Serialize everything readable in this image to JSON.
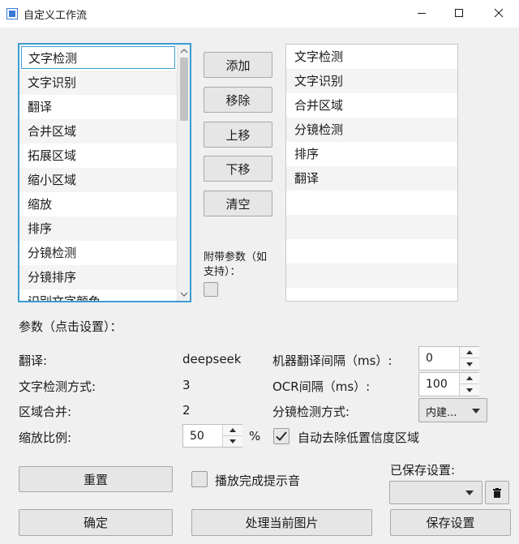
{
  "window": {
    "title": "自定义工作流",
    "minimize_icon": "minimize-icon",
    "maximize_icon": "maximize-icon",
    "close_icon": "close-icon"
  },
  "available_steps": [
    "文字检测",
    "文字识别",
    "翻译",
    "合并区域",
    "拓展区域",
    "缩小区域",
    "缩放",
    "排序",
    "分镜检测",
    "分镜排序",
    "识别文字颜色"
  ],
  "selected_steps": [
    "文字检测",
    "文字识别",
    "合并区域",
    "分镜检测",
    "排序",
    "翻译"
  ],
  "buttons": {
    "add": "添加",
    "remove": "移除",
    "move_up": "上移",
    "move_down": "下移",
    "clear": "清空",
    "reset": "重置",
    "confirm": "确定",
    "process_current": "处理当前图片",
    "save_settings": "保存设置"
  },
  "extra_params": {
    "label": "附带参数（如支持）：",
    "checked": false
  },
  "params": {
    "heading": "参数（点击设置）：",
    "translate_label": "翻译:",
    "translate_value": "deepseek",
    "text_detect_label": "文字检测方式:",
    "text_detect_value": "3",
    "region_merge_label": "区域合并:",
    "region_merge_value": "2",
    "scale_label": "缩放比例:",
    "scale_value": "50",
    "scale_unit": "%",
    "mt_interval_label": "机器翻译间隔（ms）:",
    "mt_interval_value": "0",
    "ocr_interval_label": "OCR间隔（ms）:",
    "ocr_interval_value": "100",
    "panel_detect_label": "分镜检测方式:",
    "panel_detect_value": "内建...",
    "remove_low_conf_label": "自动去除低置信度区域",
    "remove_low_conf_checked": true
  },
  "sound": {
    "label": "播放完成提示音",
    "checked": false
  },
  "saved": {
    "label": "已保存设置:",
    "value": "",
    "delete_icon": "trash-icon"
  },
  "colors": {
    "list_focus_border": "#3c9bd3",
    "window_bg": "#f0f0f0",
    "button_bg": "#e6e6e6"
  }
}
